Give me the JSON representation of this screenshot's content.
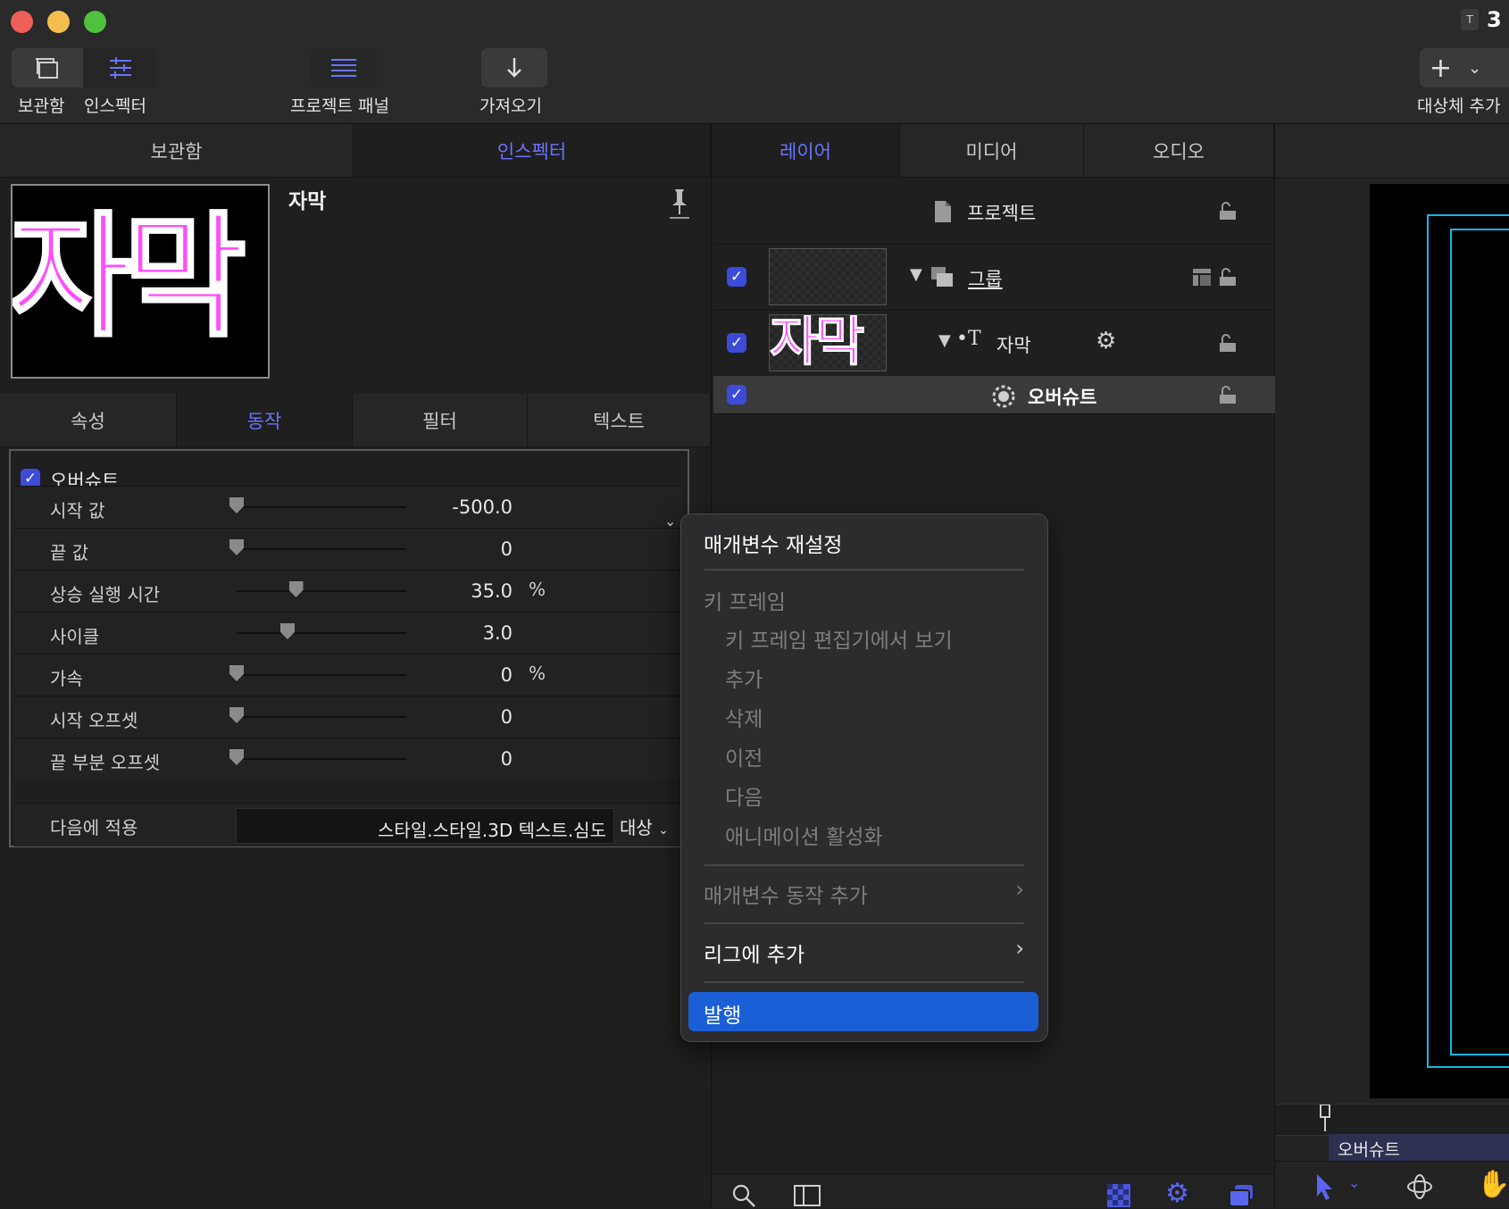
{
  "window": {
    "traffic_lights": {
      "close": "#ee5f57",
      "minimize": "#f4be4f",
      "zoom": "#4fc13e"
    },
    "title_fragment": "3"
  },
  "toolbar": {
    "library_label": "보관함",
    "inspector_label": "인스펙터",
    "project_panel_label": "프로젝트 패널",
    "import_label": "가져오기",
    "add_object_label": "대상체 추가"
  },
  "left_panel": {
    "tabs": [
      {
        "label": "보관함",
        "active": false
      },
      {
        "label": "인스펙터",
        "active": true
      }
    ],
    "preview": {
      "title": "자막",
      "thumbnail_text": "자막",
      "thumbnail_color": "#ff4dff"
    },
    "subtabs": [
      {
        "label": "속성"
      },
      {
        "label": "동작"
      },
      {
        "label": "필터"
      },
      {
        "label": "텍스트"
      }
    ],
    "behavior": {
      "name": "오버슈트",
      "enabled": true,
      "params": [
        {
          "label": "시작 값",
          "value": "-500.0",
          "unit": "",
          "level": 0.0
        },
        {
          "label": "끝 값",
          "value": "0",
          "unit": "",
          "level": 0.0
        },
        {
          "label": "상승 실행 시간",
          "value": "35.0",
          "unit": "%",
          "level": 0.35
        },
        {
          "label": "사이클",
          "value": "3.0",
          "unit": "",
          "level": 0.3
        },
        {
          "label": "가속",
          "value": "0",
          "unit": "%",
          "level": 0.0
        },
        {
          "label": "시작 오프셋",
          "value": "0",
          "unit": "",
          "level": 0.0
        },
        {
          "label": "끝 부분 오프셋",
          "value": "0",
          "unit": "",
          "level": 0.0
        }
      ],
      "apply_to": {
        "label": "다음에 적용",
        "value": "스타일.스타일.3D 텍스트.심도",
        "target": "대상"
      }
    }
  },
  "layers_panel": {
    "tabs": [
      {
        "label": "레이어",
        "active": true
      },
      {
        "label": "미디어",
        "active": false
      },
      {
        "label": "오디오",
        "active": false
      }
    ],
    "project_label": "프로젝트",
    "rows": [
      {
        "name": "그룹",
        "checked": true
      },
      {
        "name": "자막",
        "checked": true,
        "thumbnail_text": "자막"
      },
      {
        "name": "오버슈트",
        "checked": true
      }
    ]
  },
  "context_menu": {
    "reset": "매개변수 재설정",
    "keyframes_header": "키 프레임",
    "keyframe_items": [
      "키 프레임 편집기에서 보기",
      "추가",
      "삭제",
      "이전",
      "다음",
      "애니메이션 활성화"
    ],
    "add_param_behavior": "매개변수 동작 추가",
    "add_to_rig": "리그에 추가",
    "publish": "발행",
    "highlight_color": "#1a5fd6"
  },
  "canvas": {
    "timeline_label": "오버슈트",
    "guide_color": "#17b6e6"
  }
}
